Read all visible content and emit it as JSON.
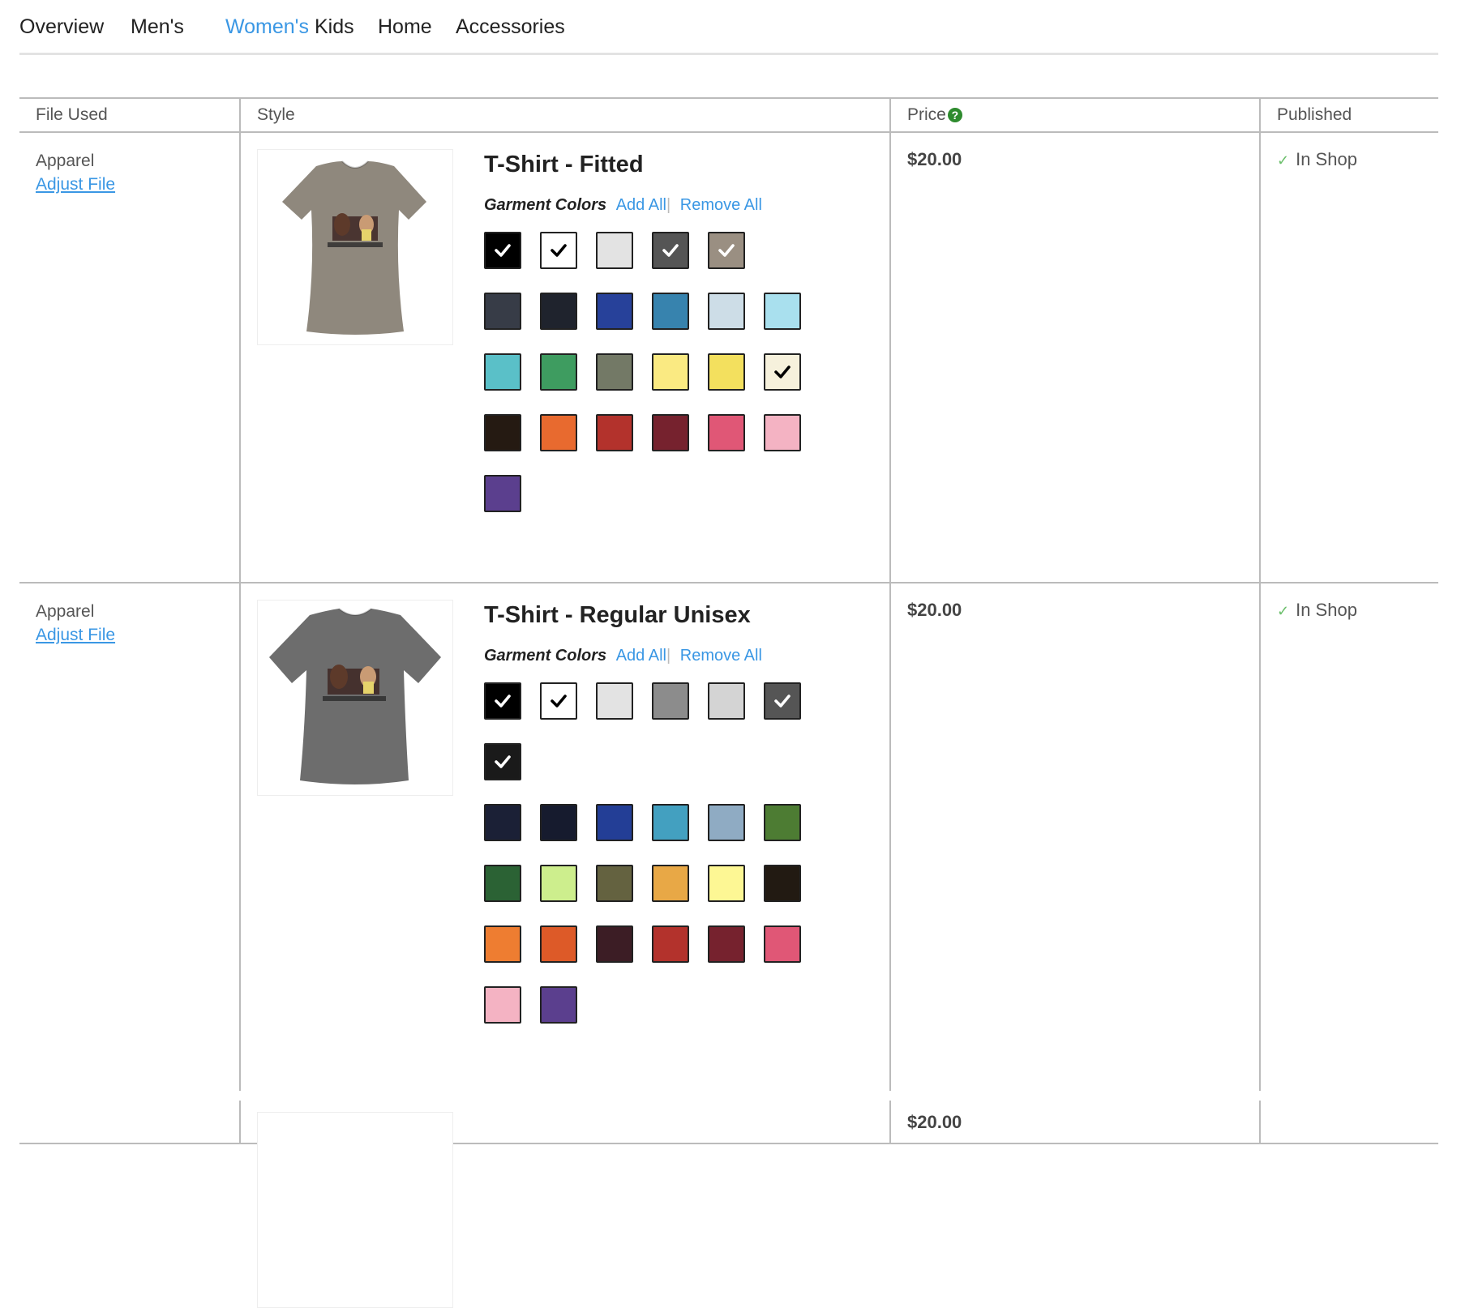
{
  "nav": {
    "tabs": [
      {
        "label": "Overview"
      },
      {
        "label": "Men's"
      },
      {
        "label": "Women's",
        "active": true
      },
      {
        "label": "Kids"
      },
      {
        "label": "Home"
      },
      {
        "label": "Accessories"
      }
    ]
  },
  "table": {
    "headers": {
      "file_used": "File Used",
      "style": "Style",
      "price": "Price",
      "published": "Published"
    }
  },
  "rows": [
    {
      "file_type": "Apparel",
      "adjust_file": "Adjust File",
      "product_name": "T-Shirt - Fitted",
      "garment_colors_label": "Garment Colors",
      "add_all": "Add All",
      "remove_all": "Remove All",
      "price": "$20.00",
      "published": "In Shop",
      "thumb_color": "#8f887d",
      "swatch_rows": [
        [
          [
            "#000000",
            true
          ],
          [
            "#ffffff",
            true
          ],
          [
            "#e3e3e3",
            false
          ],
          [
            "#555555",
            true
          ],
          [
            "#9a8f82",
            true
          ]
        ],
        [
          [
            "#373c47",
            false
          ],
          [
            "#1f232d",
            false
          ],
          [
            "#27419a",
            false
          ],
          [
            "#3783ae",
            false
          ],
          [
            "#cddde7",
            false
          ],
          [
            "#a9e0ee",
            false
          ]
        ],
        [
          [
            "#5ac0c8",
            false
          ],
          [
            "#3e9c60",
            false
          ],
          [
            "#737966",
            false
          ],
          [
            "#faea82",
            false
          ],
          [
            "#f3e05e",
            false
          ],
          [
            "#f6f1dc",
            true
          ]
        ],
        [
          [
            "#251a12",
            false
          ],
          [
            "#e86a2f",
            false
          ],
          [
            "#b3322c",
            false
          ],
          [
            "#76222e",
            false
          ],
          [
            "#e05776",
            false
          ],
          [
            "#f4b3c3",
            false
          ]
        ],
        [
          [
            "#5b3f8e",
            false
          ]
        ]
      ]
    },
    {
      "file_type": "Apparel",
      "adjust_file": "Adjust File",
      "product_name": "T-Shirt - Regular Unisex",
      "garment_colors_label": "Garment Colors",
      "add_all": "Add All",
      "remove_all": "Remove All",
      "price": "$20.00",
      "published": "In Shop",
      "thumb_color": "#6d6d6d",
      "swatch_rows": [
        [
          [
            "#000000",
            true
          ],
          [
            "#ffffff",
            true
          ],
          [
            "#e3e3e3",
            false
          ],
          [
            "#8c8c8c",
            false
          ],
          [
            "#d4d4d4",
            false
          ],
          [
            "#555555",
            true
          ]
        ],
        [
          [
            "#1a1a1a",
            true
          ]
        ],
        [
          [
            "#1b2036",
            false
          ],
          [
            "#161b2e",
            false
          ],
          [
            "#233e96",
            false
          ],
          [
            "#43a0c0",
            false
          ],
          [
            "#8fabc3",
            false
          ],
          [
            "#4d7c33",
            false
          ]
        ],
        [
          [
            "#2b6234",
            false
          ],
          [
            "#cdee8d",
            false
          ],
          [
            "#646240",
            false
          ],
          [
            "#e8a846",
            false
          ],
          [
            "#fdf794",
            false
          ],
          [
            "#221a12",
            false
          ]
        ],
        [
          [
            "#ee7d31",
            false
          ],
          [
            "#dd5a28",
            false
          ],
          [
            "#3c1d25",
            false
          ],
          [
            "#b3322c",
            false
          ],
          [
            "#76222e",
            false
          ],
          [
            "#e05776",
            false
          ]
        ],
        [
          [
            "#f4b3c3",
            false
          ],
          [
            "#5b3f8e",
            false
          ]
        ]
      ]
    },
    {
      "price": "$20.00"
    }
  ],
  "colors": {
    "accent": "#3a97e4",
    "check_light": "#ffffff",
    "check_dark": "#000000",
    "help_icon": "#2e8b2e",
    "published_check": "#6bbf6b"
  }
}
